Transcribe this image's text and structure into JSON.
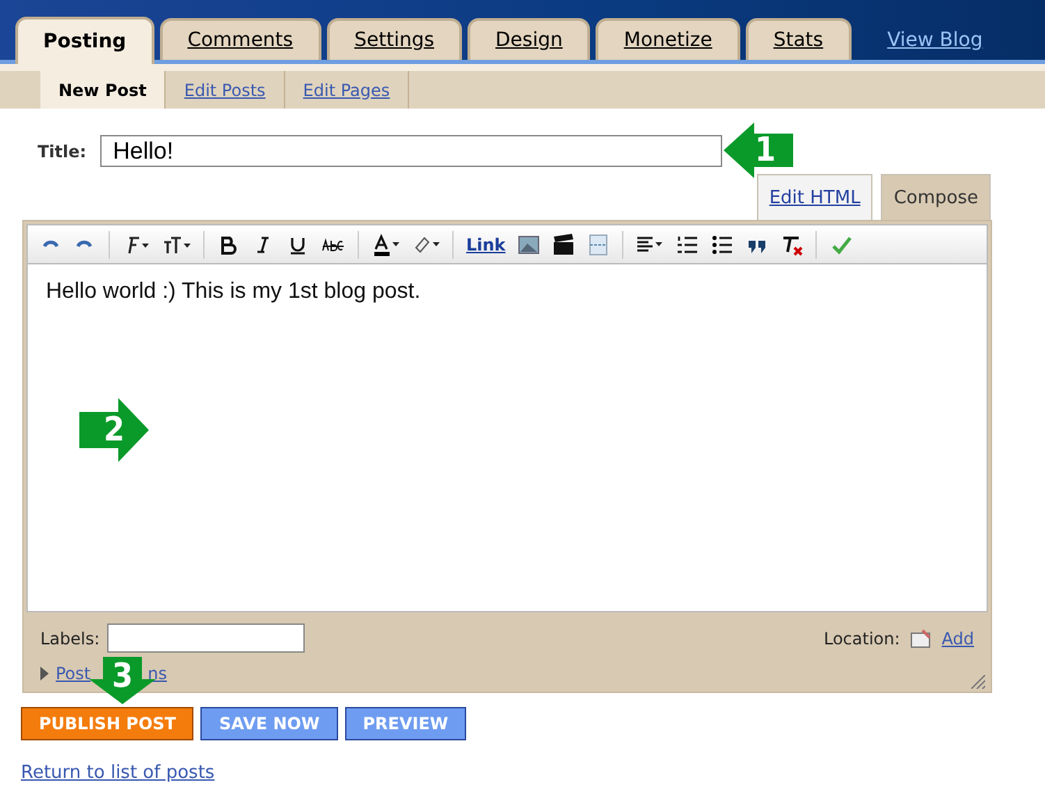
{
  "main_tabs": [
    {
      "label": "Posting",
      "selected": true
    },
    {
      "label": "Comments",
      "selected": false
    },
    {
      "label": "Settings",
      "selected": false
    },
    {
      "label": "Design",
      "selected": false
    },
    {
      "label": "Monetize",
      "selected": false
    },
    {
      "label": "Stats",
      "selected": false
    }
  ],
  "view_blog_link": "View Blog",
  "sub_tabs": [
    {
      "label": "New Post",
      "selected": true
    },
    {
      "label": "Edit Posts",
      "selected": false
    },
    {
      "label": "Edit Pages",
      "selected": false
    }
  ],
  "title_field": {
    "label": "Title:",
    "value": "Hello!"
  },
  "editor_modes": [
    {
      "label": "Edit HTML",
      "selected": false
    },
    {
      "label": "Compose",
      "selected": true
    }
  ],
  "toolbar": {
    "link_label": "Link"
  },
  "editor_body": "Hello world :) This is my 1st blog post.",
  "labels_field": {
    "label": "Labels:"
  },
  "location": {
    "label": "Location:",
    "link": "Add"
  },
  "post_options_link": {
    "visible_parts": [
      "Post",
      "ns"
    ]
  },
  "buttons": [
    {
      "label": "PUBLISH POST",
      "kind": "primary"
    },
    {
      "label": "SAVE NOW",
      "kind": "secondary"
    },
    {
      "label": "PREVIEW",
      "kind": "secondary"
    }
  ],
  "return_link": "Return to list of posts",
  "annotations": [
    {
      "label": "1",
      "kind": "left"
    },
    {
      "label": "2",
      "kind": "right"
    },
    {
      "label": "3",
      "kind": "down"
    }
  ]
}
